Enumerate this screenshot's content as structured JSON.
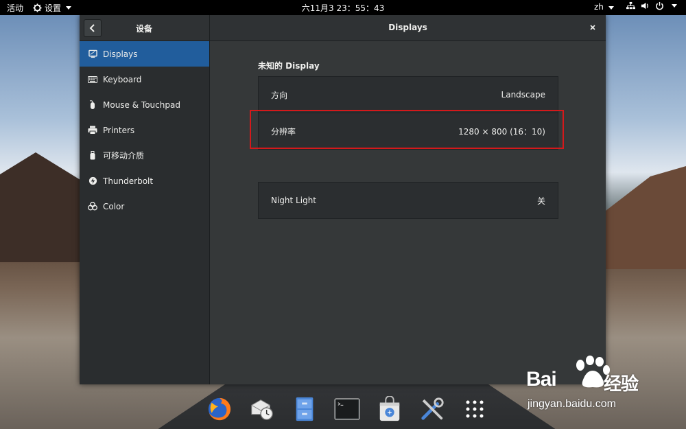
{
  "topbar": {
    "activities": "活动",
    "app_menu": "设置",
    "clock": "六11月3 23：55：43",
    "lang": "zh"
  },
  "window": {
    "sidebar_title": "设备",
    "title": "Displays"
  },
  "sidebar": {
    "items": [
      {
        "label": "Displays",
        "icon": "display-icon",
        "active": true
      },
      {
        "label": "Keyboard",
        "icon": "keyboard-icon",
        "active": false
      },
      {
        "label": "Mouse & Touchpad",
        "icon": "mouse-icon",
        "active": false
      },
      {
        "label": "Printers",
        "icon": "printer-icon",
        "active": false
      },
      {
        "label": "可移动介质",
        "icon": "usb-drive-icon",
        "active": false
      },
      {
        "label": "Thunderbolt",
        "icon": "thunderbolt-icon",
        "active": false
      },
      {
        "label": "Color",
        "icon": "color-icon",
        "active": false
      }
    ]
  },
  "content": {
    "section_title": "未知的 Display",
    "orientation_label": "方向",
    "orientation_value": "Landscape",
    "resolution_label": "分辨率",
    "resolution_value": "1280 × 800 (16：10)",
    "night_light_label": "Night Light",
    "night_light_value": "关"
  },
  "dock": {
    "apps": [
      "firefox-icon",
      "evolution-mail-icon",
      "file-cabinet-icon",
      "terminal-icon",
      "software-store-icon",
      "tools-icon",
      "app-grid-icon"
    ]
  },
  "watermark": {
    "brand": "Bai",
    "brand_cn": "经验",
    "url": "jingyan.baidu.com"
  },
  "colors": {
    "accent": "#215d9c",
    "highlight": "#d4191b",
    "topbar": "#000000"
  }
}
